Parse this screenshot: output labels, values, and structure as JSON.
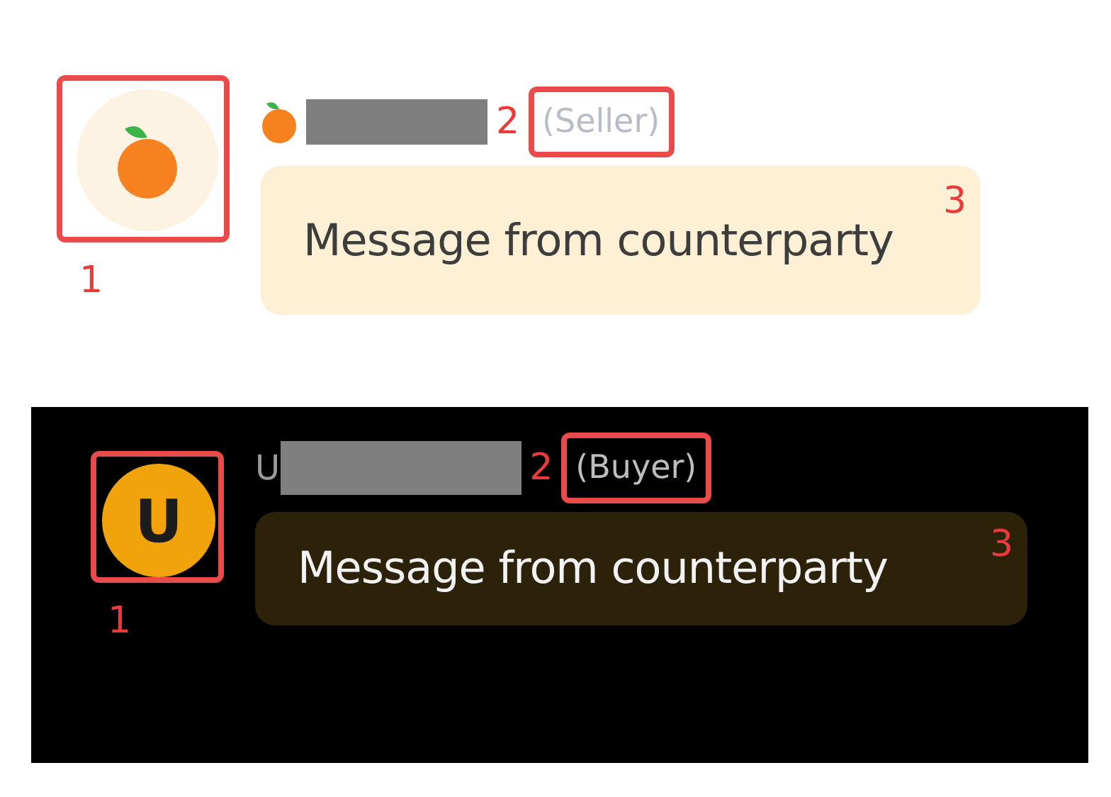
{
  "panels": [
    {
      "dark": false,
      "avatar": {
        "kind": "fruit"
      },
      "role": "(Seller)",
      "message": "Message from counterparty",
      "markers": {
        "avatar": "1",
        "role": "2",
        "message": "3"
      }
    },
    {
      "dark": true,
      "avatar": {
        "kind": "letter",
        "letter": "U"
      },
      "name_prefix": "U",
      "role": "(Buyer)",
      "message": "Message from counterparty",
      "markers": {
        "avatar": "1",
        "role": "2",
        "message": "3"
      }
    }
  ]
}
